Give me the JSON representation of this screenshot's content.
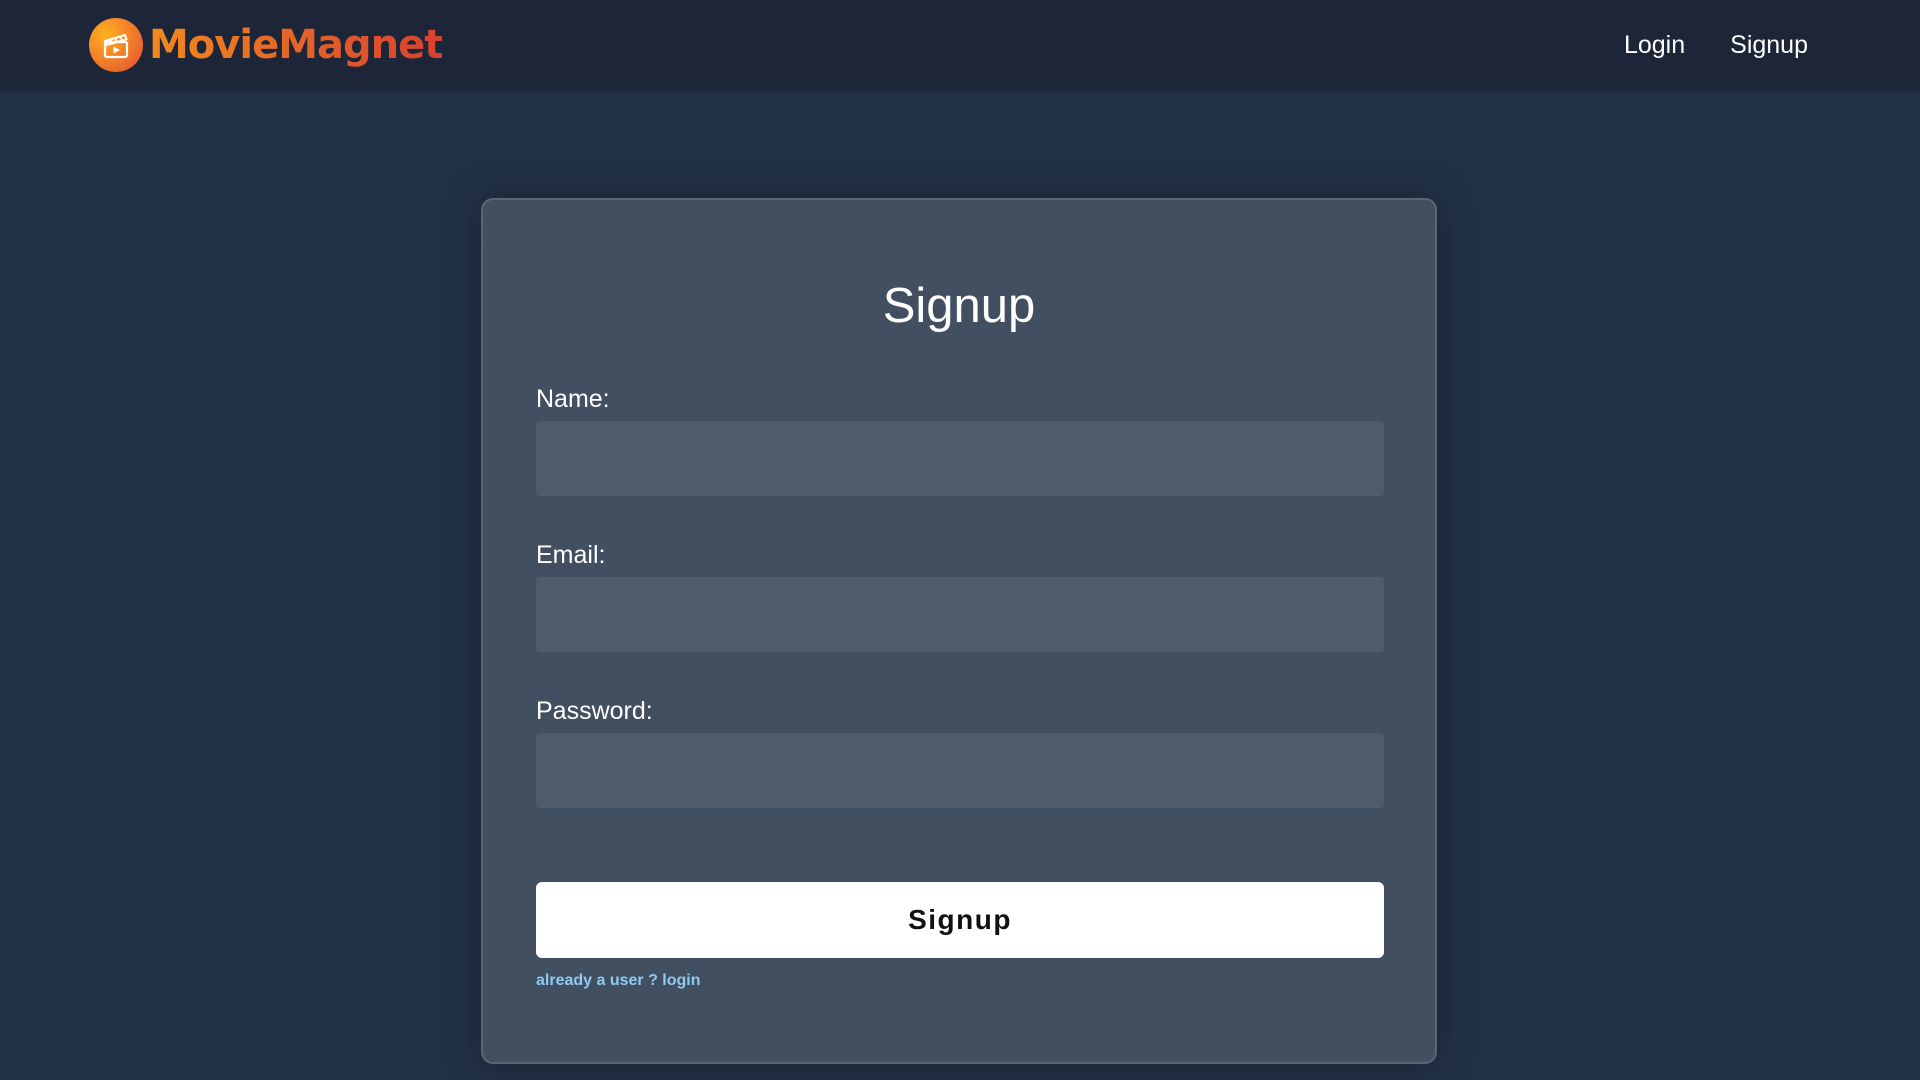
{
  "brand": {
    "name": "MovieMagnet",
    "logo_icon": "film-clapper-icon",
    "colors": {
      "gradient_start": "#f08a1c",
      "gradient_end": "#d8402f"
    }
  },
  "nav": {
    "items": [
      {
        "label": "Login"
      },
      {
        "label": "Signup"
      }
    ]
  },
  "form": {
    "title": "Signup",
    "fields": [
      {
        "label": "Name:",
        "value": "",
        "placeholder": ""
      },
      {
        "label": "Email:",
        "value": "",
        "placeholder": ""
      },
      {
        "label": "Password:",
        "value": "",
        "placeholder": ""
      }
    ],
    "submit_label": "Signup",
    "login_link": "already a user ? login"
  },
  "colors": {
    "page_bg": "#233147",
    "navbar_bg": "#1d2638",
    "card_bg": "#424f61",
    "input_bg": "#4f5b6b",
    "link": "#8fc9f0"
  }
}
